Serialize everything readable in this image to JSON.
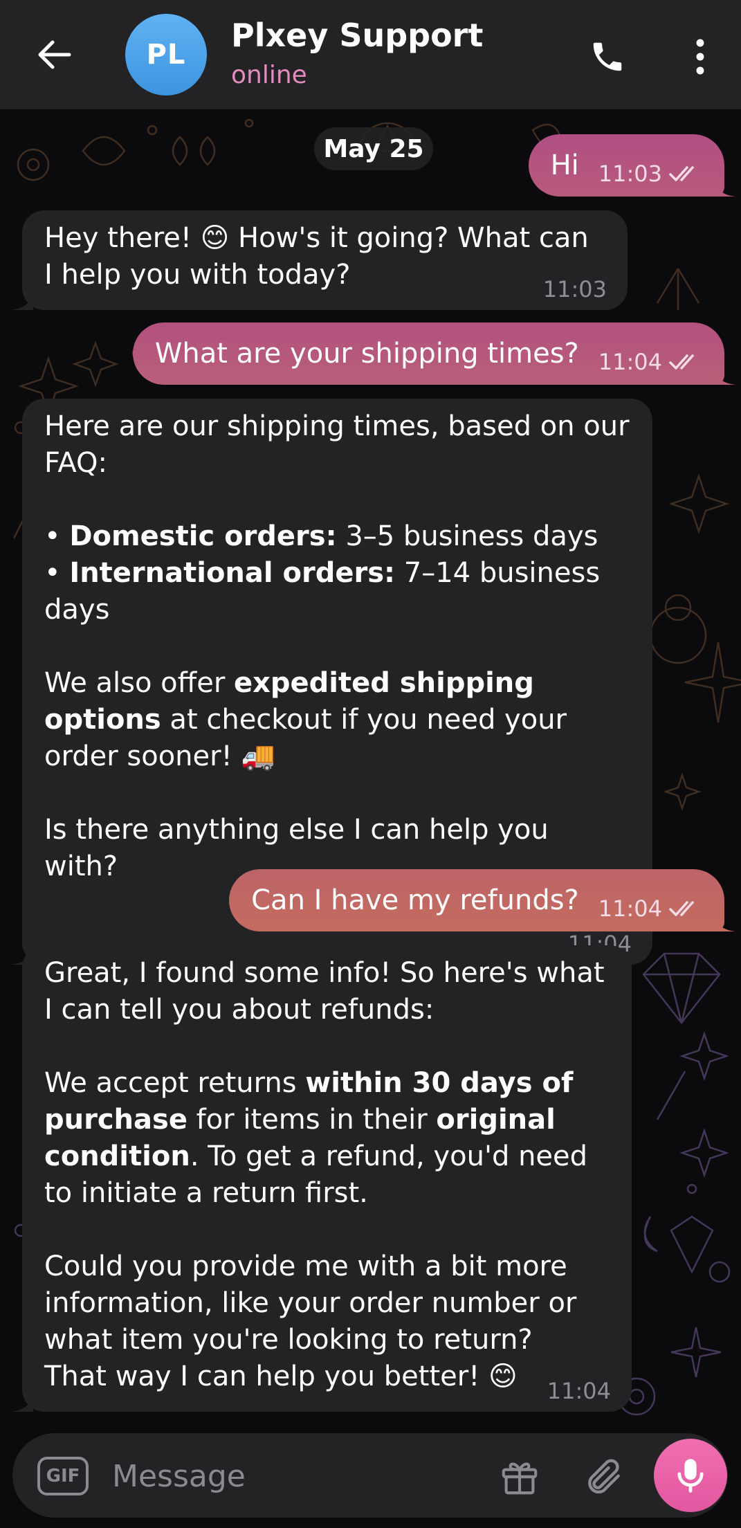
{
  "header": {
    "avatar_initials": "PL",
    "title": "Plxey Support",
    "status": "online",
    "status_color": "#e58bbd",
    "avatar_color": "#4aa3ea",
    "back_icon": "arrow-left-icon",
    "call_icon": "phone-icon",
    "menu_icon": "more-vertical-icon"
  },
  "chat": {
    "date_label": "May 25",
    "outgoing_gradient_top": "#b9577f",
    "outgoing_gradient_bottom": "#c77062",
    "messages": [
      {
        "direction": "out",
        "text": "Hi",
        "time": "11:03",
        "status": "read"
      },
      {
        "direction": "in",
        "text": "Hey there! 😊 How's it going? What can I help you with today?",
        "time": "11:03"
      },
      {
        "direction": "out",
        "text": "What are your shipping times?",
        "time": "11:04",
        "status": "read"
      },
      {
        "direction": "in",
        "time": "11:04",
        "intro": "Here are our shipping times, based on our FAQ:",
        "bullets": [
          {
            "label": "Domestic orders:",
            "value": "3–5 business days"
          },
          {
            "label": "International orders:",
            "value": "7–14 business days"
          }
        ],
        "expedited_pre": "We also offer ",
        "expedited_bold": "expedited shipping options",
        "expedited_post": " at checkout if you need your order sooner! 🚚",
        "closing": "Is there anything else I can help you with?"
      },
      {
        "direction": "out",
        "text": "Can I have my refunds?",
        "time": "11:04",
        "status": "read"
      },
      {
        "direction": "in",
        "time": "11:04",
        "intro": "Great, I found some info! So here's what I can tell you about refunds:",
        "policy_pre": "We accept returns ",
        "policy_bold1": "within 30 days of purchase",
        "policy_mid": " for items in their ",
        "policy_bold2": "original condition",
        "policy_post": ". To get a refund, you'd need to initiate a return first.",
        "closing": "Could you provide me with a bit more information, like your order number or what item you're looking to return? That way I can help you better! 😊"
      }
    ]
  },
  "composer": {
    "gif_label": "GIF",
    "placeholder": "Message",
    "value": "",
    "gift_icon": "gift-icon",
    "attach_icon": "paperclip-icon",
    "mic_icon": "microphone-icon",
    "mic_color": "#ea63a8"
  }
}
